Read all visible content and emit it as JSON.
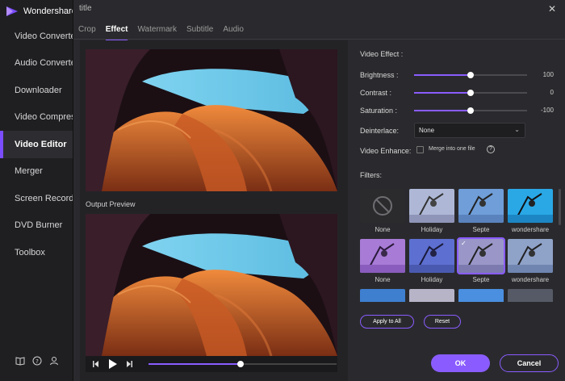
{
  "app": {
    "name": "Wondershare"
  },
  "sidebar": {
    "items": [
      {
        "label": "Video Converter",
        "active": false
      },
      {
        "label": "Audio Converter",
        "active": false
      },
      {
        "label": "Downloader",
        "active": false
      },
      {
        "label": "Video Compressor",
        "active": false
      },
      {
        "label": "Video Editor",
        "active": true
      },
      {
        "label": "Merger",
        "active": false
      },
      {
        "label": "Screen Recorder",
        "active": false
      },
      {
        "label": "DVD Burner",
        "active": false
      },
      {
        "label": "Toolbox",
        "active": false
      }
    ],
    "footer_icons": [
      "book-icon",
      "help-icon",
      "account-icon"
    ]
  },
  "dialog": {
    "title": "title",
    "tabs": [
      {
        "label": "Crop",
        "active": false
      },
      {
        "label": "Effect",
        "active": true
      },
      {
        "label": "Watermark",
        "active": false
      },
      {
        "label": "Subtitle",
        "active": false
      },
      {
        "label": "Audio",
        "active": false
      }
    ],
    "output_preview_label": "Output Preview",
    "playback_progress": 0.49
  },
  "effect": {
    "section_title": "Video Effect :",
    "brightness": {
      "label": "Brightness :",
      "value": "100",
      "level": 0.5
    },
    "contrast": {
      "label": "Contrast :",
      "value": "0",
      "level": 0.5
    },
    "saturation": {
      "label": "Saturation :",
      "value": "-100",
      "level": 0.5
    },
    "deinterlace": {
      "label": "Deinterlace:",
      "value": "None"
    },
    "enhance": {
      "label": "Video Enhance:",
      "checkbox_label": "Merge into one file",
      "checked": false
    },
    "filters_label": "Filters:",
    "filters": [
      {
        "name": "None",
        "selected": false
      },
      {
        "name": "Holiday",
        "selected": false
      },
      {
        "name": "Septe",
        "selected": false
      },
      {
        "name": "wondershare",
        "selected": false
      },
      {
        "name": "None",
        "selected": false
      },
      {
        "name": "Holiday",
        "selected": false
      },
      {
        "name": "Septe",
        "selected": true
      },
      {
        "name": "wondershare",
        "selected": false
      }
    ]
  },
  "buttons": {
    "apply_to_all": "Apply to All",
    "reset": "Reset",
    "ok": "OK",
    "cancel": "Cancel"
  },
  "colors": {
    "accent": "#8a5cff",
    "background": "#2a2a2e",
    "sidebar": "#1f1f22"
  }
}
